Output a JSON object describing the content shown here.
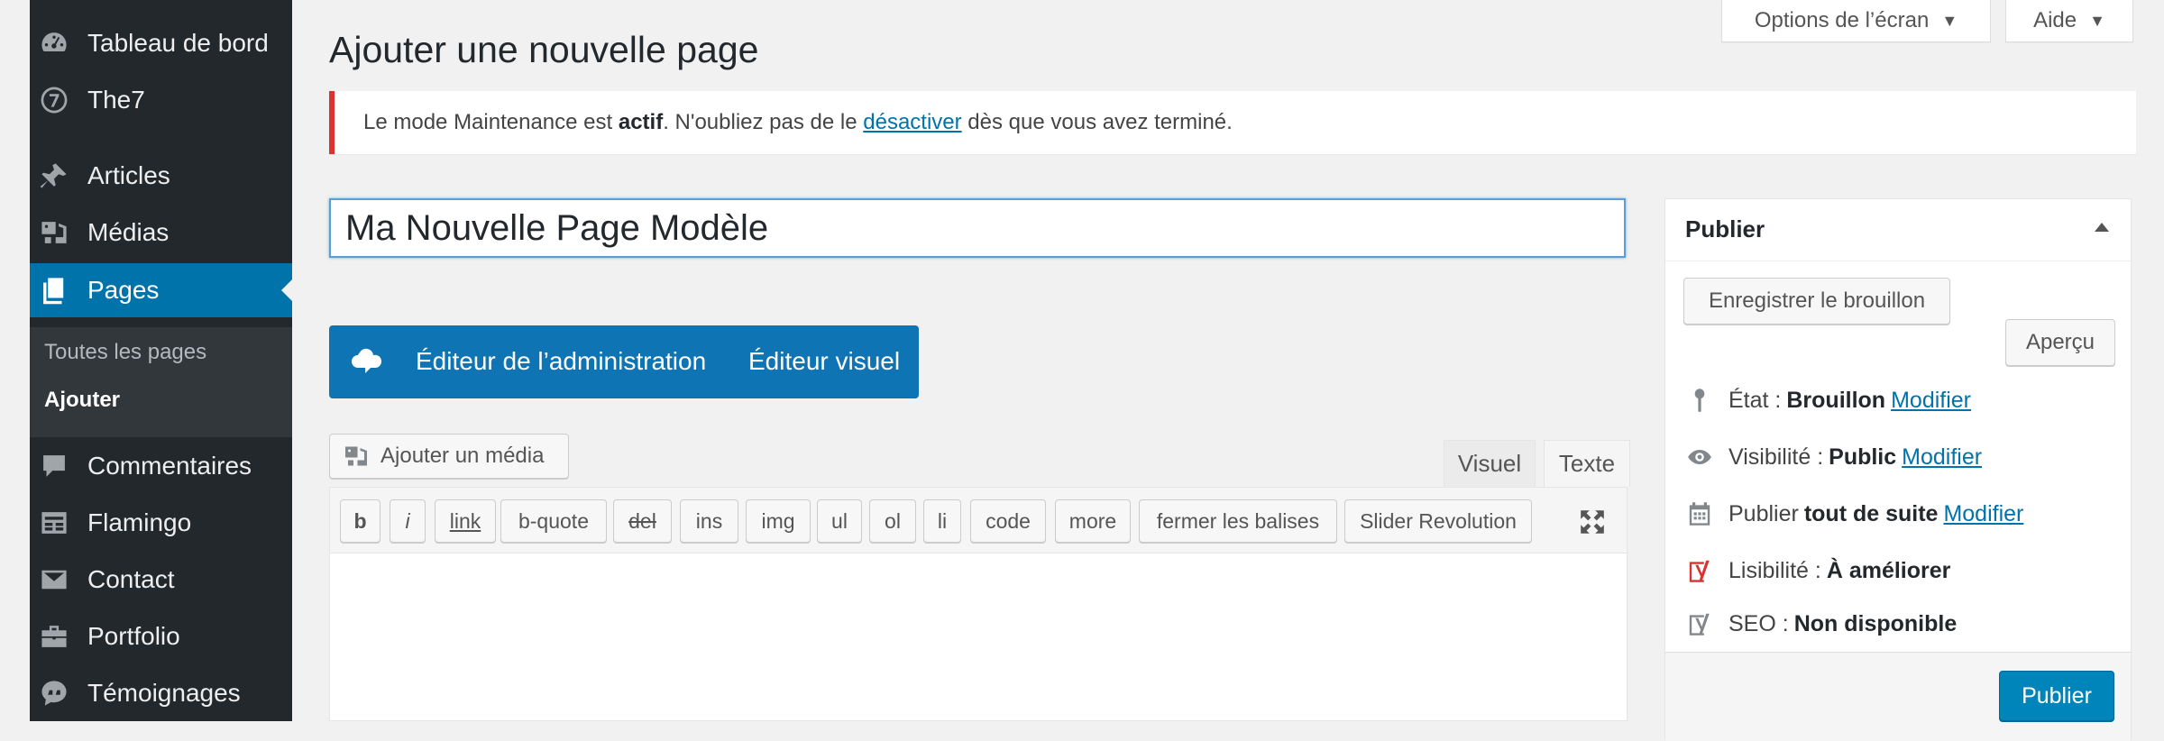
{
  "sidebar": {
    "items": [
      {
        "label": "Tableau de bord",
        "icon": "dashboard-icon"
      },
      {
        "label": "The7",
        "icon": "the7-icon"
      },
      {
        "label": "Articles",
        "icon": "pin-icon"
      },
      {
        "label": "Médias",
        "icon": "media-icon"
      },
      {
        "label": "Pages",
        "icon": "pages-icon"
      },
      {
        "label": "Commentaires",
        "icon": "comments-icon"
      },
      {
        "label": "Flamingo",
        "icon": "flamingo-icon"
      },
      {
        "label": "Contact",
        "icon": "mail-icon"
      },
      {
        "label": "Portfolio",
        "icon": "portfolio-icon"
      },
      {
        "label": "Témoignages",
        "icon": "testimonials-icon"
      }
    ],
    "submenu": {
      "all_pages": "Toutes les pages",
      "add": "Ajouter"
    }
  },
  "screen_options": {
    "label": "Options de l’écran",
    "help": "Aide"
  },
  "page_title": "Ajouter une nouvelle page",
  "notice": {
    "prefix": "Le mode Maintenance est ",
    "bold": "actif",
    "middle": ". N'oubliez pas de le ",
    "link": "désactiver",
    "suffix": " dès que vous avez terminé."
  },
  "title_value": "Ma Nouvelle Page Modèle",
  "builder": {
    "admin_editor": "Éditeur de l’administration",
    "visual_editor": "Éditeur visuel"
  },
  "editor": {
    "add_media": "Ajouter un média",
    "tab_visual": "Visuel",
    "tab_text": "Texte",
    "quicktags": [
      "b",
      "i",
      "link",
      "b-quote",
      "del",
      "ins",
      "img",
      "ul",
      "ol",
      "li",
      "code",
      "more",
      "fermer les balises",
      "Slider Revolution"
    ]
  },
  "publish": {
    "title": "Publier",
    "save_draft": "Enregistrer le brouillon",
    "preview": "Aperçu",
    "status_label": "État :",
    "status_value": "Brouillon",
    "visibility_label": "Visibilité :",
    "visibility_value": "Public",
    "publish_label": "Publier",
    "publish_value": "tout de suite",
    "modify": "Modifier",
    "readability_label": "Lisibilité :",
    "readability_value": "À améliorer",
    "seo_label": "SEO :",
    "seo_value": "Non disponible",
    "publish_button": "Publier"
  },
  "colors": {
    "accent": "#0073aa",
    "sidebar": "#23282d",
    "notice_border": "#dc3232",
    "builder": "#0e74b4",
    "yoast_red": "#dc3232"
  }
}
